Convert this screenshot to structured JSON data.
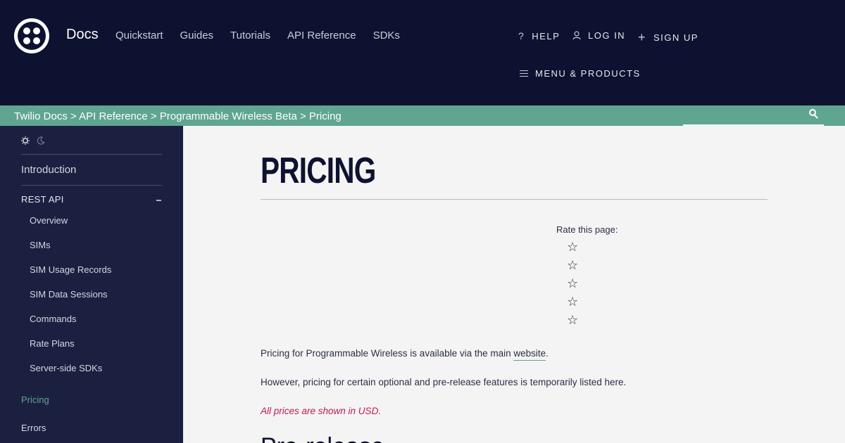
{
  "header": {
    "brand": "Docs",
    "nav": [
      "Quickstart",
      "Guides",
      "Tutorials",
      "API Reference",
      "SDKs"
    ],
    "help": "HELP",
    "help_icon": "?",
    "login": "LOG IN",
    "signup": "SIGN UP",
    "signup_icon": "+",
    "menu": "MENU & PRODUCTS"
  },
  "breadcrumb": "Twilio Docs > API Reference > Programmable Wireless Beta > Pricing",
  "sidebar": {
    "intro": "Introduction",
    "group": "REST API",
    "items": [
      "Overview",
      "SIMs",
      "SIM Usage Records",
      "SIM Data Sessions",
      "Commands",
      "Rate Plans",
      "Server-side SDKs"
    ],
    "pricing": "Pricing",
    "errors": "Errors"
  },
  "main": {
    "title": "PRICING",
    "rate_label": "Rate this page:",
    "star_glyph": "☆",
    "p1_pre": "Pricing for Programmable Wireless is available via the main ",
    "p1_link": "website",
    "p1_post": ".",
    "p2": "However, pricing for certain optional and pre-release features is temporarily listed here.",
    "note": "All prices are shown in USD.",
    "subhead": "Pre-release"
  },
  "colors": {
    "header_bg": "#0d1230",
    "accent": "#5fa590",
    "sidebar_bg": "#1c2040",
    "note": "#c01a50"
  }
}
